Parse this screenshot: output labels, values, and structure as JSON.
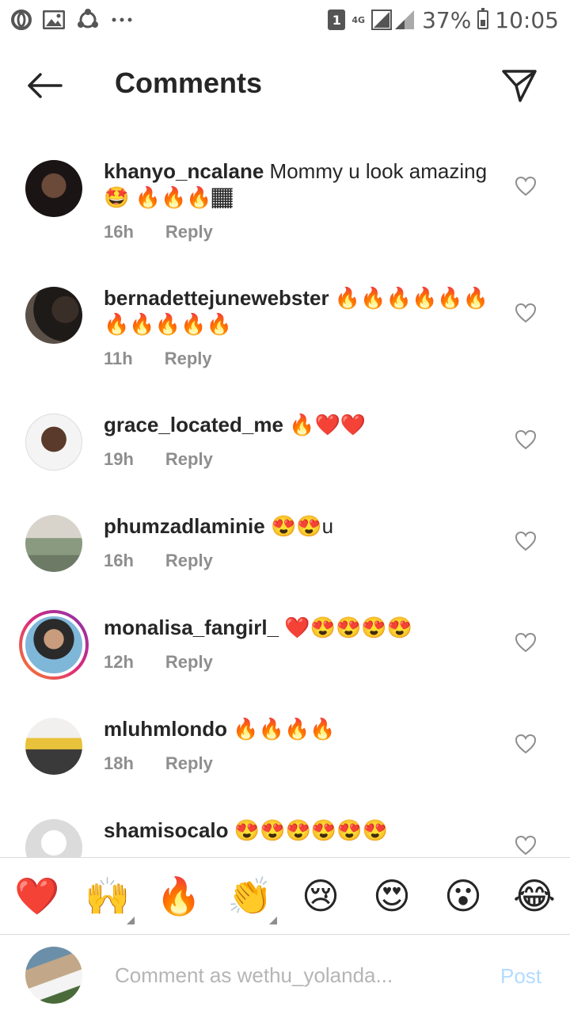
{
  "status_bar": {
    "sim_badge": "1",
    "network": "4G",
    "battery": "37%",
    "time": "10:05",
    "icons": [
      "opera-icon",
      "gallery-icon",
      "sync-icon",
      "more-dots-icon"
    ]
  },
  "header": {
    "title": "Comments",
    "back_icon": "arrow-left-icon",
    "send_icon": "paper-plane-icon"
  },
  "comments": [
    {
      "username": "khanyo_ncalane",
      "text": "Mommy u look amazing 🤩 🔥🔥🔥🏾",
      "time": "16h",
      "reply": "Reply"
    },
    {
      "username": "bernadettejunewebster",
      "text": "🔥🔥🔥🔥🔥🔥🔥🔥🔥🔥🔥",
      "time": "11h",
      "reply": "Reply"
    },
    {
      "username": "grace_located_me",
      "text": "🔥❤️❤️",
      "time": "19h",
      "reply": "Reply"
    },
    {
      "username": "phumzadlaminie",
      "text": "😍😍u",
      "time": "16h",
      "reply": "Reply"
    },
    {
      "username": "monalisa_fangirl_",
      "text": "❤️😍😍😍😍",
      "time": "12h",
      "reply": "Reply"
    },
    {
      "username": "mluhmlondo",
      "text": "🔥🔥🔥🔥",
      "time": "18h",
      "reply": "Reply"
    },
    {
      "username": "shamisocalo",
      "text": "😍😍😍😍😍😍",
      "time": "",
      "reply": ""
    }
  ],
  "emoji_bar": [
    "❤️",
    "🙌",
    "🔥",
    "👏",
    "😢",
    "😍",
    "😮",
    "😂"
  ],
  "composer": {
    "placeholder": "Comment as wethu_yolanda...",
    "post_label": "Post"
  },
  "colors": {
    "text": "#262626",
    "muted": "#8e8e8e",
    "post_disabled": "#b3dbff",
    "story_ring": "#dd2a7b"
  }
}
